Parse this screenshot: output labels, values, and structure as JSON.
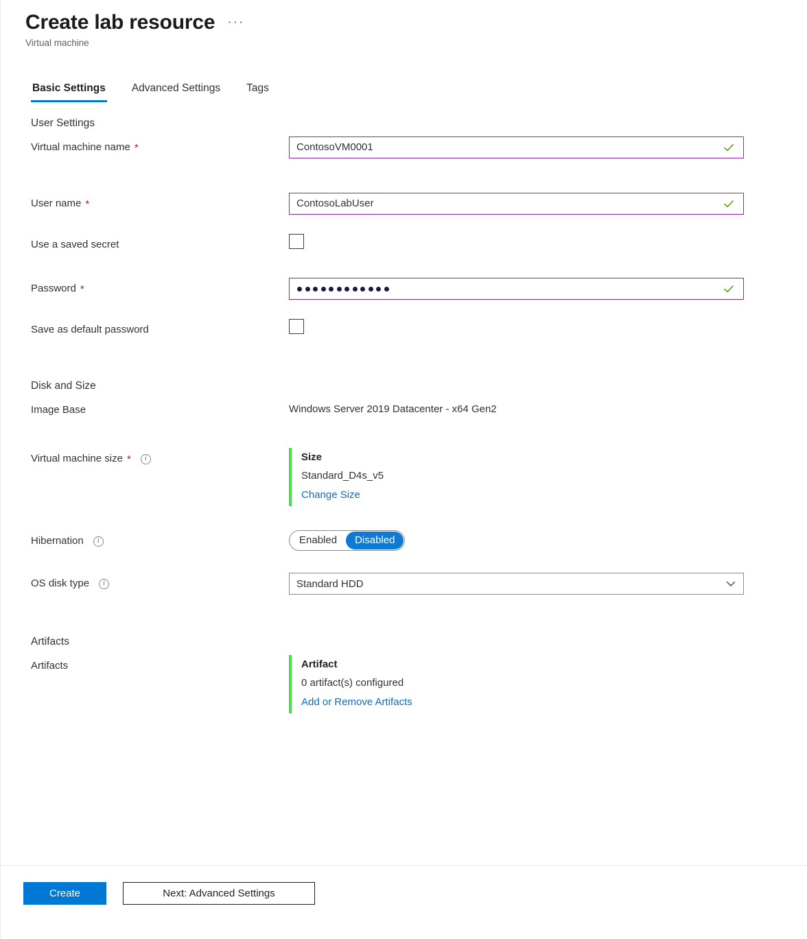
{
  "header": {
    "title": "Create lab resource",
    "more_label": "···",
    "subtitle": "Virtual machine"
  },
  "tabs": [
    {
      "label": "Basic Settings",
      "active": true
    },
    {
      "label": "Advanced Settings",
      "active": false
    },
    {
      "label": "Tags",
      "active": false
    }
  ],
  "sections": {
    "user_settings": {
      "heading": "User Settings",
      "vm_name": {
        "label": "Virtual machine name",
        "required_mark": "*",
        "value": "ContosoVM0001",
        "validation": "valid-check-icon"
      },
      "user_name": {
        "label": "User name",
        "required_mark": "*",
        "value": "ContosoLabUser",
        "validation": "valid-check-icon"
      },
      "use_saved_secret": {
        "label": "Use a saved secret",
        "checked": false
      },
      "password": {
        "label": "Password",
        "required_mark": "*",
        "masked_length": 12,
        "validation": "valid-check-icon"
      },
      "save_default_password": {
        "label": "Save as default password",
        "checked": false
      }
    },
    "disk_and_size": {
      "heading": "Disk and Size",
      "image_base": {
        "label": "Image Base",
        "value": "Windows Server 2019 Datacenter - x64 Gen2"
      },
      "vm_size": {
        "label": "Virtual machine size",
        "required_mark": "*",
        "info_icon": "info-icon",
        "callout_title": "Size",
        "callout_value": "Standard_D4s_v5",
        "callout_link": "Change Size"
      },
      "hibernation": {
        "label": "Hibernation",
        "info_icon": "info-icon",
        "options": [
          "Enabled",
          "Disabled"
        ],
        "selected": "Disabled"
      },
      "os_disk_type": {
        "label": "OS disk type",
        "info_icon": "info-icon",
        "value": "Standard HDD",
        "chevron": "chevron-down-icon"
      }
    },
    "artifacts": {
      "heading": "Artifacts",
      "row_label": "Artifacts",
      "callout_title": "Artifact",
      "callout_value": "0 artifact(s) configured",
      "callout_link": "Add or Remove Artifacts"
    }
  },
  "footer": {
    "create_label": "Create",
    "next_label": "Next: Advanced Settings"
  },
  "colors": {
    "accent_blue": "#0078d4",
    "link_blue": "#0f6cbd",
    "required_red": "#a4262c",
    "input_border_purple": "#8e24aa",
    "valid_green": "#57a300",
    "callout_green": "#46e046"
  }
}
